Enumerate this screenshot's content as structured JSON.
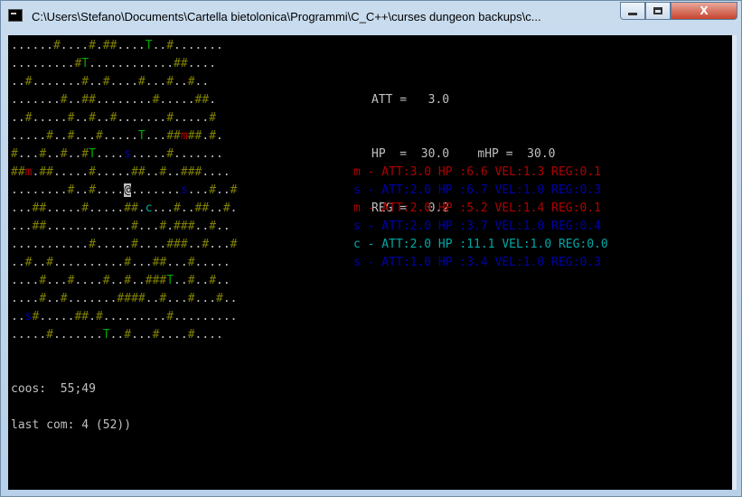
{
  "window": {
    "title": "C:\\Users\\Stefano\\Documents\\Cartella bietolonica\\Programmi\\C_C++\\curses dungeon backups\\c...",
    "close_label": "X"
  },
  "map": {
    "rows": [
      "......#....#.##....T..#.......",
      ".........#T............##....",
      "..#.......#..#....#...#..#..",
      ".......#..##........#.....##.",
      "..#.....#..#..#.......#.....#",
      ".....#..#...#.....T...##m##.#.",
      "#...#..#..#T....s.....#.......",
      "##m.##.....#.....##..#..###....",
      "........#..#....@.......s...#..#",
      "...##.....#.....##.c...#..##..#.",
      "...##............#...#.###..#..",
      "...........#.....#....###..#...#",
      "..#..#..........#...##...#.....",
      "....#...#....#..#..###T..#..#..",
      "....#..#.......####..#...#...#..",
      "..s#.....##.#.........#.........",
      ".....#.......T..#...#....#...."
    ],
    "legend_colors": {
      "floor": "#c0c0c0",
      "wall": "#808000",
      "tree": "#00aa00",
      "monster_m": "#b00000",
      "monster_s": "#0000a8",
      "monster_c": "#00a8a8"
    }
  },
  "stats": {
    "att_line": "ATT =   3.0",
    "hp_line": "HP  =  30.0    mHP =  30.0",
    "reg_line": "REG =   0.2"
  },
  "monsters": [
    {
      "text": "m - ATT:3.0 HP :6.6 VEL:1.3 REG:0.1",
      "color": "#b00000"
    },
    {
      "text": "s - ATT:2.0 HP :6.7 VEL:1.0 REG:0.3",
      "color": "#0000a8"
    },
    {
      "text": "m - ATT:2.0 HP :5.2 VEL:1.4 REG:0.1",
      "color": "#b00000"
    },
    {
      "text": "s - ATT:2.0 HP :3.7 VEL:1.0 REG:0.4",
      "color": "#0000a8"
    },
    {
      "text": "c - ATT:2.0 HP :11.1 VEL:1.0 REG:0.0",
      "color": "#00a8a8"
    },
    {
      "text": "s - ATT:1.0 HP :3.4 VEL:1.0 REG:0.3",
      "color": "#0000a8"
    }
  ],
  "status": {
    "coos": "coos:  55;49",
    "last_com": "last com: 4 (52))"
  }
}
